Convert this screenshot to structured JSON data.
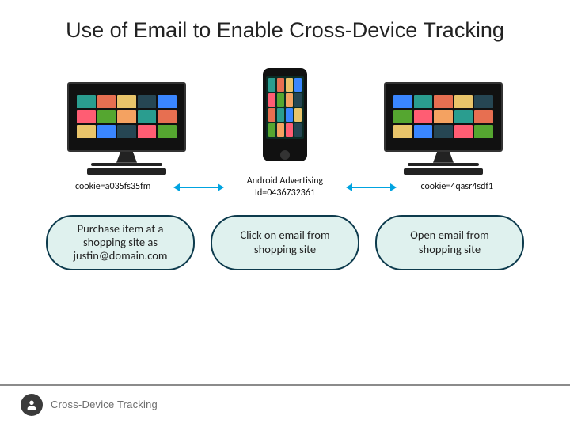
{
  "title": "Use of Email to Enable Cross-Device Tracking",
  "devices": {
    "left_id": "cookie=a035fs35fm",
    "center_id_line1": "Android Advertising",
    "center_id_line2": "Id=0436732361",
    "right_id": "cookie=4qasr4sdf1"
  },
  "actions": {
    "left": "Purchase item at a shopping site as justin@domain.com",
    "center": "Click on email from shopping site",
    "right": "Open email from shopping site"
  },
  "footer": {
    "label": "Cross-Device Tracking"
  },
  "colors": {
    "arrow": "#00a3e0",
    "box_fill": "#dff1ee",
    "box_border": "#0d3b4d"
  }
}
